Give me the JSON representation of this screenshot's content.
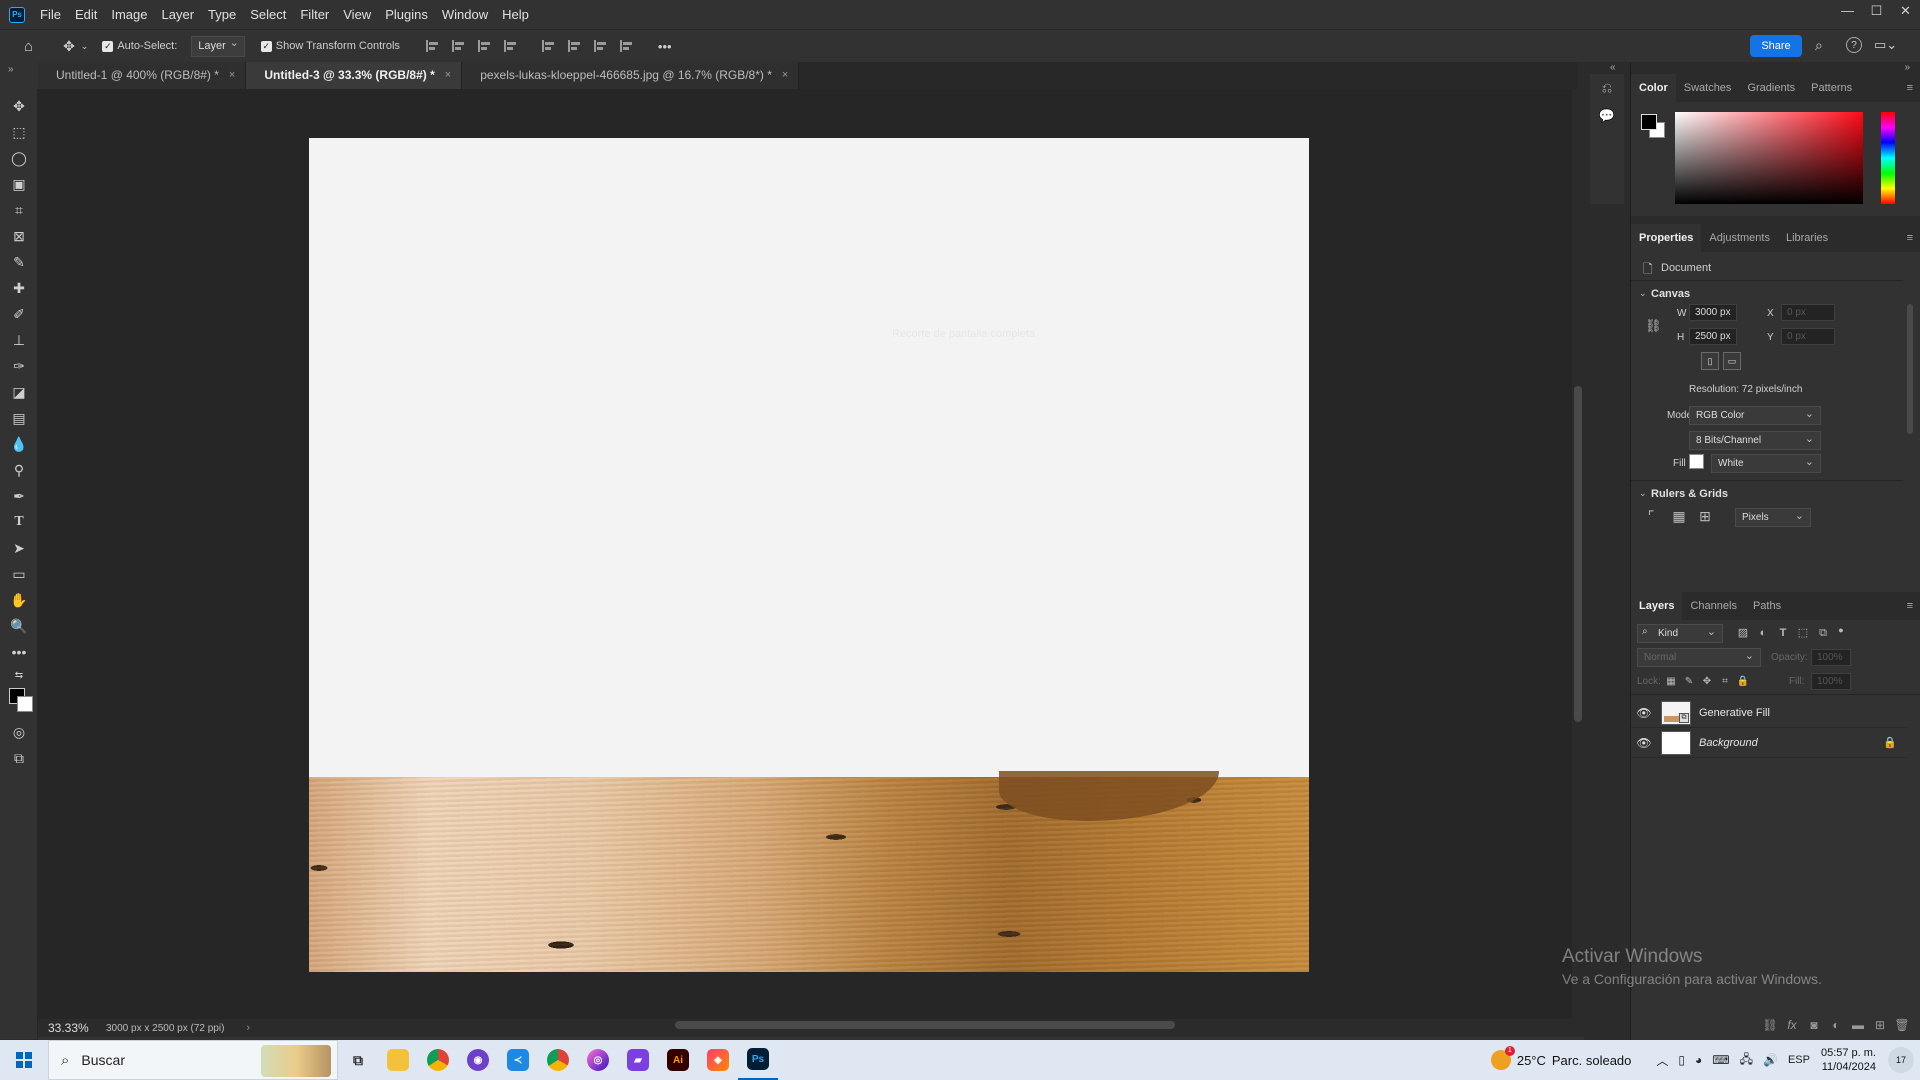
{
  "app": {
    "logo_text": "Ps"
  },
  "menu": [
    "File",
    "Edit",
    "Image",
    "Layer",
    "Type",
    "Select",
    "Filter",
    "View",
    "Plugins",
    "Window",
    "Help"
  ],
  "window_controls": {
    "minimize": "—",
    "maximize": "☐",
    "close": "✕"
  },
  "options_bar": {
    "auto_select_label": "Auto-Select:",
    "auto_select_checked": true,
    "auto_select_target": "Layer",
    "transform_controls_label": "Show Transform Controls",
    "more_label": "•••",
    "share_label": "Share"
  },
  "tabs": [
    {
      "label": "Untitled-1 @ 400% (RGB/8#) *",
      "active": false
    },
    {
      "label": "Untitled-3 @ 33.3% (RGB/8#) *",
      "active": true
    },
    {
      "label": "pexels-lukas-kloeppel-466685.jpg @ 16.7% (RGB/8*) *",
      "active": false
    }
  ],
  "tools": [
    "move",
    "marquee",
    "lasso",
    "object-select",
    "crop",
    "frame",
    "eyedropper",
    "healing",
    "brush",
    "stamp",
    "history-brush",
    "eraser",
    "gradient",
    "blur",
    "dodge",
    "pen",
    "type",
    "path-select",
    "rectangle",
    "hand",
    "zoom",
    "more"
  ],
  "canvas": {
    "ghost_text": "Recorte de pantalla completa"
  },
  "status": {
    "zoom": "33.33%",
    "doc_info": "3000 px x 2500 px (72 ppi)"
  },
  "color_panel": {
    "tabs": [
      "Color",
      "Swatches",
      "Gradients",
      "Patterns"
    ],
    "foreground": "#000000",
    "background": "#ffffff"
  },
  "properties_panel": {
    "tabs": [
      "Properties",
      "Adjustments",
      "Libraries"
    ],
    "document_label": "Document",
    "canvas_title": "Canvas",
    "w_label": "W",
    "w_value": "3000 px",
    "h_label": "H",
    "h_value": "2500 px",
    "x_label": "X",
    "x_value": "0 px",
    "y_label": "Y",
    "y_value": "0 px",
    "resolution": "Resolution: 72 pixels/inch",
    "mode_label": "Mode",
    "mode_value": "RGB Color",
    "bits_value": "8 Bits/Channel",
    "fill_label": "Fill",
    "fill_value": "White",
    "rulers_title": "Rulers & Grids",
    "units_value": "Pixels"
  },
  "layers_panel": {
    "tabs": [
      "Layers",
      "Channels",
      "Paths"
    ],
    "filter_kind": "Kind",
    "blend_mode": "Normal",
    "opacity_label": "Opacity:",
    "opacity_value": "100%",
    "lock_label": "Lock:",
    "fill_label": "Fill:",
    "fill_value": "100%",
    "layers": [
      {
        "name": "Generative Fill",
        "visible": true,
        "locked": false
      },
      {
        "name": "Background",
        "visible": true,
        "locked": true
      }
    ]
  },
  "watermark": {
    "title": "Activar Windows",
    "subtitle": "Ve a Configuración para activar Windows."
  },
  "taskbar": {
    "search_placeholder": "Buscar",
    "weather_temp": "25°C",
    "weather_desc": "Parc. soleado",
    "weather_badge": "1",
    "language": "ESP",
    "time": "05:57 p. m.",
    "date": "11/04/2024",
    "notifications": "17"
  }
}
